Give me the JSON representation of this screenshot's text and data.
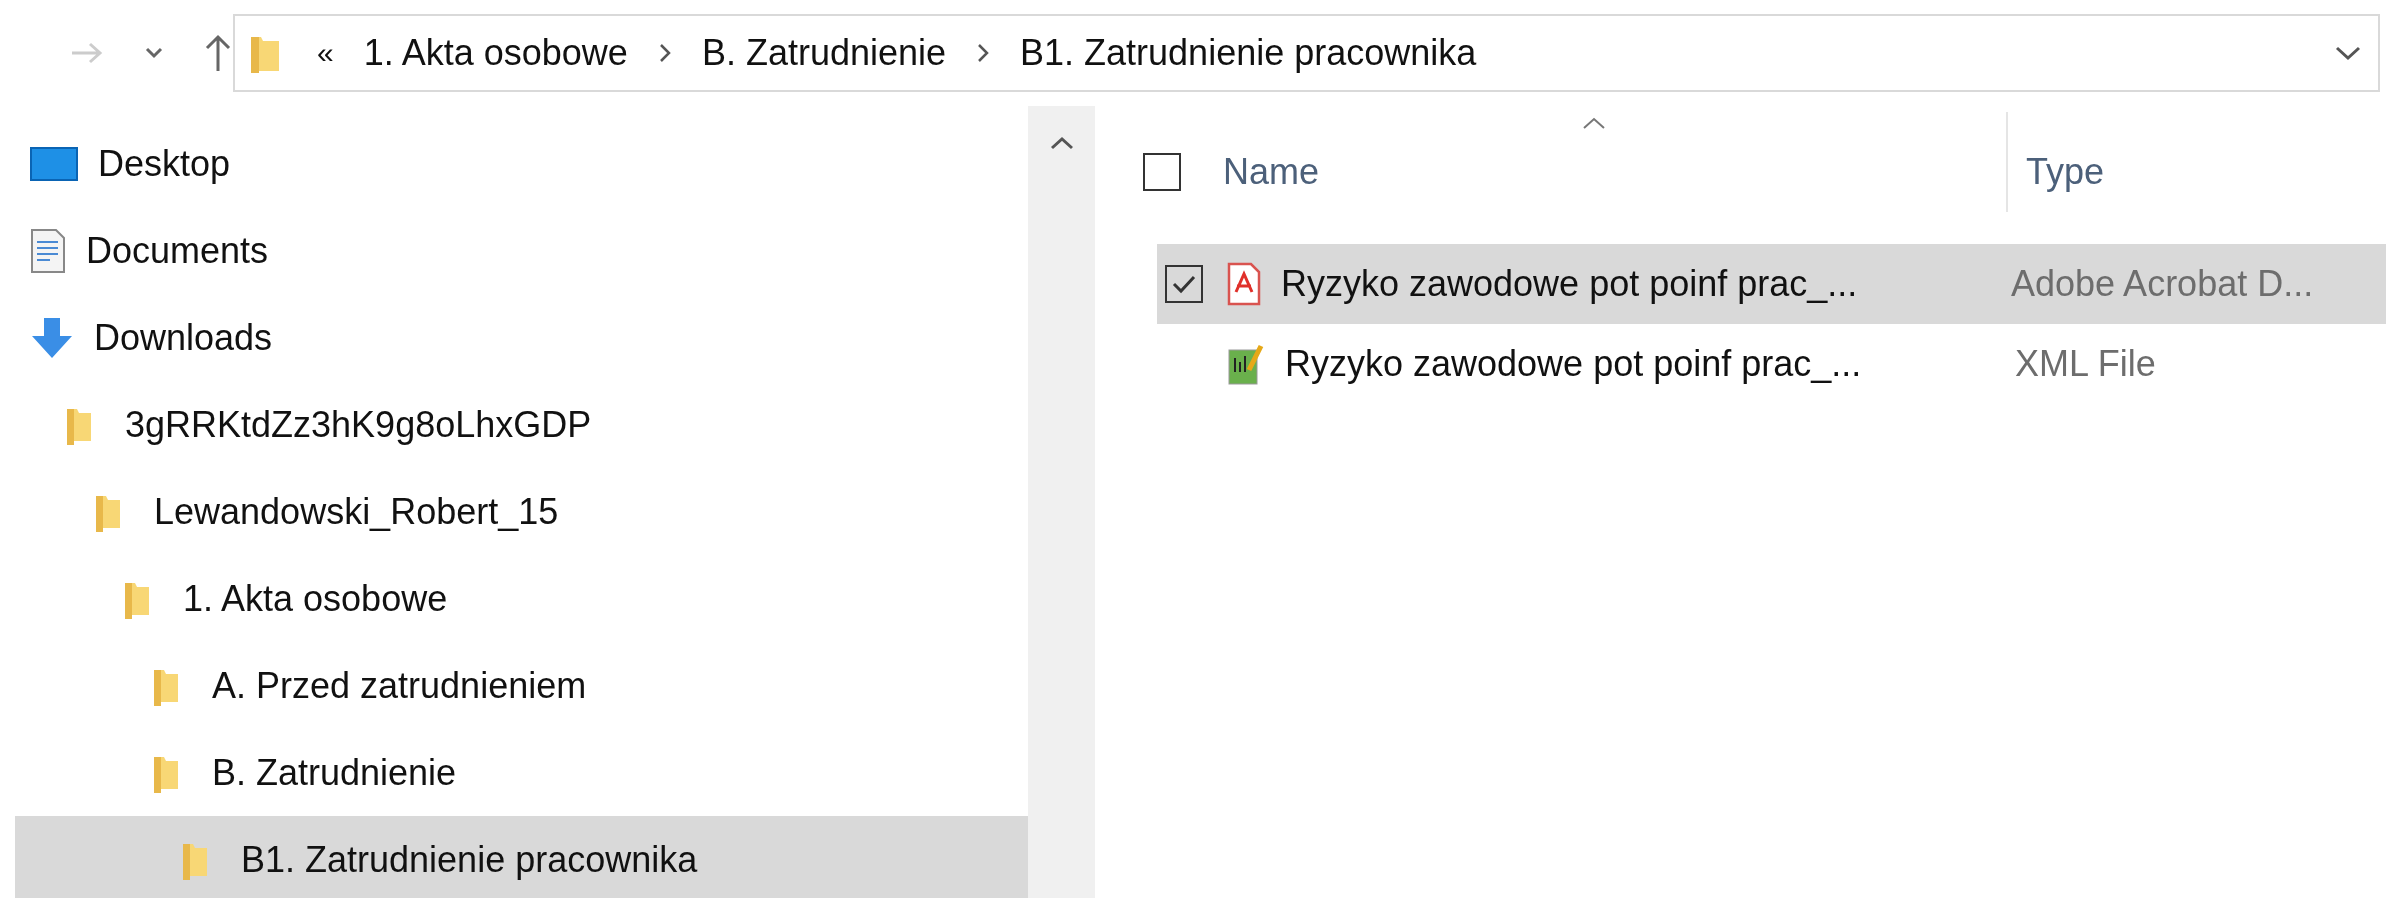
{
  "nav_buttons": [
    {
      "kind": "forward",
      "disabled": true
    },
    {
      "kind": "recent",
      "disabled": false
    },
    {
      "kind": "up",
      "disabled": false
    }
  ],
  "address_bar": {
    "overflow": "«",
    "crumbs": [
      "1. Akta osobowe",
      "B. Zatrudnienie",
      "B1. Zatrudnienie pracownika"
    ]
  },
  "sidebar": {
    "items": [
      {
        "label": "Desktop",
        "kind": "desktop",
        "selected": false
      },
      {
        "label": "Documents",
        "kind": "documents",
        "selected": false
      },
      {
        "label": "Downloads",
        "kind": "downloads",
        "selected": false,
        "children": [
          {
            "label": "3gRRKtdZz3hK9g8oLhxGDP",
            "kind": "folder",
            "selected": false,
            "children": [
              {
                "label": "Lewandowski_Robert_15",
                "kind": "folder",
                "selected": false,
                "children": [
                  {
                    "label": "1. Akta osobowe",
                    "kind": "folder",
                    "selected": false,
                    "children": [
                      {
                        "label": "A. Przed zatrudnieniem",
                        "kind": "folder",
                        "selected": false
                      },
                      {
                        "label": "B. Zatrudnienie",
                        "kind": "folder",
                        "selected": false,
                        "children": [
                          {
                            "label": "B1. Zatrudnienie pracownika",
                            "kind": "folder",
                            "selected": true
                          }
                        ]
                      }
                    ]
                  }
                ]
              }
            ]
          }
        ]
      }
    ]
  },
  "file_list": {
    "select_all_checked": false,
    "columns": [
      {
        "label": "Name",
        "sorted": true
      },
      {
        "label": "Type",
        "sorted": false
      }
    ],
    "rows": [
      {
        "name": "Ryzyko zawodowe pot poinf prac_...",
        "type": "Adobe Acrobat D...",
        "kind": "pdf",
        "selected": true
      },
      {
        "name": "Ryzyko zawodowe pot poinf prac_...",
        "type": "XML File",
        "kind": "xml",
        "selected": false
      }
    ]
  }
}
